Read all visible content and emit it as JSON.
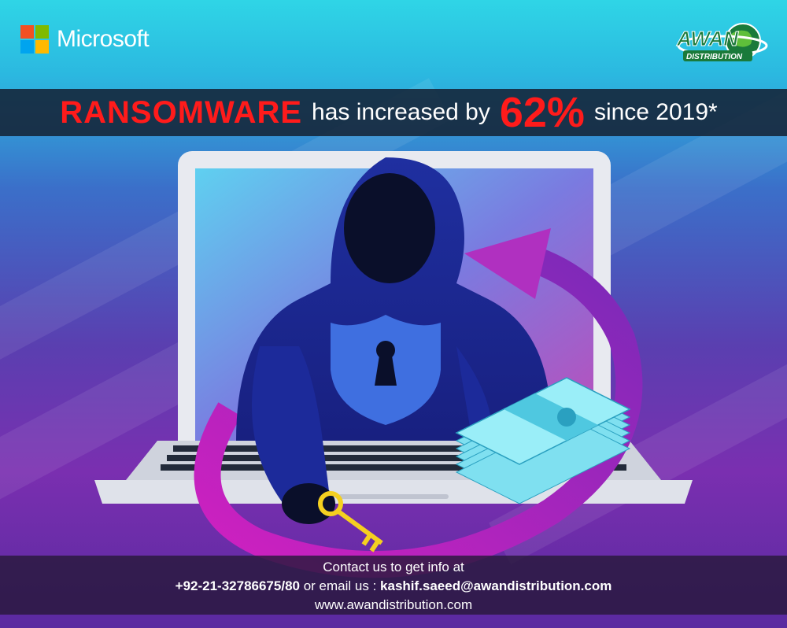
{
  "brand": {
    "microsoft_label": "Microsoft",
    "awan_label": "AWAN",
    "awan_sub": "DISTRIBUTION"
  },
  "headline": {
    "word1": "RANSOMWARE",
    "middle": "has increased by",
    "percent": "62%",
    "suffix": "since 2019*"
  },
  "contact": {
    "intro": "Contact us to get info at",
    "phone": "+92-21-32786675/80",
    "connector": "or email us :",
    "email": "kashif.saeed@awandistribution.com",
    "website": "www.awandistribution.com"
  },
  "icons": [
    "microsoft-logo-icon",
    "globe-icon",
    "hacker-figure",
    "shield-keyhole-icon",
    "key-icon",
    "cash-stack-icon",
    "cycle-arrow-icon",
    "laptop-icon"
  ]
}
